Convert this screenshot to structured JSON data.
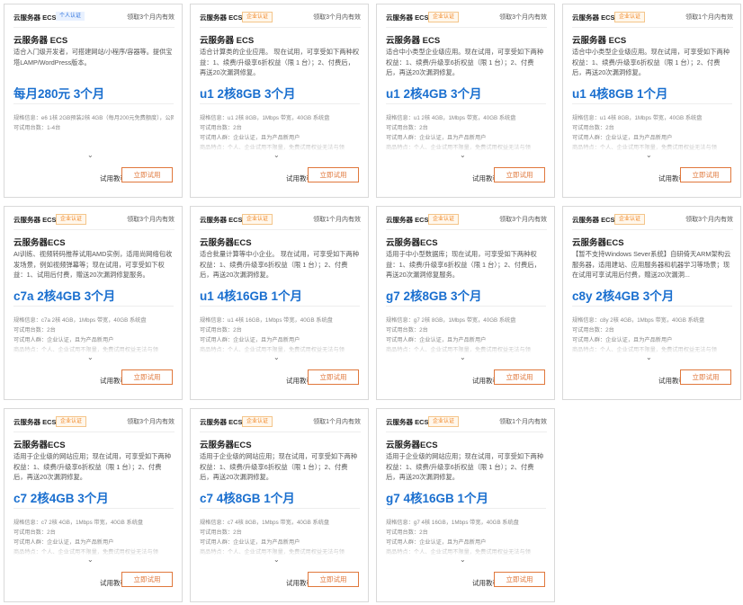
{
  "cards": [
    {
      "brand": "云服务器 ECS",
      "badge": "个人认证",
      "badge_color": "#2a6fdb",
      "validity": "领取3个月内有效",
      "title": "云服务器 ECS",
      "description": "适合入门级开发者，可搭建网站/小程序/容器等。提供宝塔LAMP/WordPress版本。",
      "spec": "每月280元 3个月",
      "details": [
        "规格信息：e6 1核 2GB预装2核 4GB（每月200元免费额度），公网免费额度：超出免费每月80元出免费额度部分需自付",
        "可试用台数：1-4台"
      ],
      "tutorial": "试用教程",
      "button": "立即试用"
    },
    {
      "brand": "云服务器 ECS",
      "badge": "企业认证",
      "badge_color": "#f0821e",
      "validity": "领取3个月内有效",
      "title": "云服务器 ECS",
      "description": "适合计算类的企业应用。 现在试用，可享受如下两种权益：1、续费/升级享6折权益（限 1 台）；2、付费后，再送20次漏洞修复。",
      "spec": "u1 2核8GB 3个月",
      "details": [
        "规格信息：u1 2核 8GB，1Mbps 带宽，40GB 系统盘",
        "可试用台数：2台",
        "可试用人群：企业认证，且为产品新用户",
        "商品特点：个人、企业试用不限量，免费试用权益无法与领"
      ],
      "tutorial": "试用教程",
      "button": "立即试用"
    },
    {
      "brand": "云服务器 ECS",
      "badge": "企业认证",
      "badge_color": "#f0821e",
      "validity": "领取3个月内有效",
      "title": "云服务器 ECS",
      "description": "适合中小类型企业级应用。现在试用，可享受如下两种权益：1、续费/升级享6折权益（限 1 台）；2、付费后，再送20次漏洞修复。",
      "spec": "u1 2核4GB 3个月",
      "details": [
        "规格信息：u1 2核 4GB，1Mbps 带宽，40GB 系统盘",
        "可试用台数：2台",
        "可试用人群：企业认证，且为产品新用户",
        "商品特点：个人、企业试用不限量，免费试用权益无法与领"
      ],
      "tutorial": "试用教程",
      "button": "立即试用"
    },
    {
      "brand": "云服务器 ECS",
      "badge": "企业认证",
      "badge_color": "#f0821e",
      "validity": "领取1个月内有效",
      "title": "云服务器 ECS",
      "description": "适合中小类型企业级应用。现在试用，可享受如下两种权益：1、续费/升级享6折权益（限 1 台）；2、付费后，再送20次漏洞修复。",
      "spec": "u1 4核8GB 1个月",
      "details": [
        "规格信息：u1 4核 8GB，1Mbps 带宽，40GB 系统盘",
        "可试用台数：2台",
        "可试用人群：企业认证，且为产品新用户",
        "商品特点：个人、企业试用不限量，免费试用权益无法与领"
      ],
      "tutorial": "试用教程",
      "button": "立即试用"
    },
    {
      "brand": "云服务器 ECS",
      "badge": "企业认证",
      "badge_color": "#f0821e",
      "validity": "领取3个月内有效",
      "title": "云服务器ECS",
      "description": "AI训练、视频转码推荐试用AMD实例，适用尚网络包收发场景，例如视频弹幕等；现在试用，可享受如下权益：1、试用后付费，赠送20次漏洞修复服务。",
      "spec": "c7a 2核4GB 3个月",
      "details": [
        "规格信息：c7a 2核 4GB，1Mbps 带宽，40GB 系统盘",
        "可试用台数：2台",
        "可试用人群：企业认证，且为产品新用户",
        "商品特点：个人、企业试用不限量，免费试用权益无法与领"
      ],
      "tutorial": "试用教程",
      "button": "立即试用"
    },
    {
      "brand": "云服务器 ECS",
      "badge": "企业认证",
      "badge_color": "#f0821e",
      "validity": "领取1个月内有效",
      "title": "云服务器ECS",
      "description": "适合批量计算等中小企业。 现在试用，可享受如下两种权益：1、续费/升级享6折权益（限 1 台）；2、付费后，再送20次漏洞修复。",
      "spec": "u1 4核16GB 1个月",
      "details": [
        "规格信息：u1 4核 16GB，1Mbps 带宽，40GB 系统盘",
        "可试用台数：2台",
        "可试用人群：企业认证，且为产品新用户",
        "商品特点：个人、企业试用不限量，免费试用权益无法与领"
      ],
      "tutorial": "试用教程",
      "button": "立即试用"
    },
    {
      "brand": "云服务器 ECS",
      "badge": "企业认证",
      "badge_color": "#f0821e",
      "validity": "领取3个月内有效",
      "title": "云服务器ECS",
      "description": "适用于中小型数据库；现在试用，可享受如下两种权益：1、续费/升级享6折权益（限 1 台）；2、付费后，再送20次漏洞修复服务。",
      "spec": "g7 2核8GB 3个月",
      "details": [
        "规格信息：g7 2核 8GB，1Mbps 带宽，40GB 系统盘",
        "可试用台数：2台",
        "可试用人群：企业认证，且为产品新用户",
        "商品特点：个人、企业试用不限量，免费试用权益无法与领"
      ],
      "tutorial": "试用教程",
      "button": "立即试用"
    },
    {
      "brand": "云服务器 ECS",
      "badge": "企业认证",
      "badge_color": "#f0821e",
      "validity": "领取3个月内有效",
      "title": "云服务器ECS",
      "description": "【暂不支持Windows Sever系统】自研倚天ARM架构云服务器，适用建站、应用服务器和机器学习等场景；现在试用可享试用后付费，赠送20次漏洞...",
      "spec": "c8y 2核4GB 3个月",
      "details": [
        "规格信息：c8y 2核 4GB，1Mbps 带宽，40GB 系统盘",
        "可试用台数：2台",
        "可试用人群：企业认证，且为产品新用户",
        "商品特点：个人、企业试用不限量，免费试用权益无法与领"
      ],
      "tutorial": "试用教程",
      "button": "立即试用"
    },
    {
      "brand": "云服务器 ECS",
      "badge": "企业认证",
      "badge_color": "#f0821e",
      "validity": "领取3个月内有效",
      "title": "云服务器ECS",
      "description": "适用于企业级的网站应用；现在试用，可享受如下两种权益：1、续费/升级享6折权益（限 1 台）；2、付费后，再送20次漏洞修复。",
      "spec": "c7 2核4GB 3个月",
      "details": [
        "规格信息：c7 2核 4GB，1Mbps 带宽，40GB 系统盘",
        "可试用台数：2台",
        "可试用人群：企业认证，且为产品新用户",
        "商品特点：个人、企业试用不限量，免费试用权益无法与领"
      ],
      "tutorial": "试用教程",
      "button": "立即试用"
    },
    {
      "brand": "云服务器 ECS",
      "badge": "企业认证",
      "badge_color": "#f0821e",
      "validity": "领取1个月内有效",
      "title": "云服务器ECS",
      "description": "适用于企业级的网站应用；现在试用，可享受如下两种权益：1、续费/升级享6折权益（限 1 台）；2、付费后，再送20次漏洞修复。",
      "spec": "c7 4核8GB 1个月",
      "details": [
        "规格信息：c7 4核 8GB，1Mbps 带宽，40GB 系统盘",
        "可试用台数：2台",
        "可试用人群：企业认证，且为产品新用户",
        "商品特点：个人、企业试用不限量，免费试用权益无法与领"
      ],
      "tutorial": "试用教程",
      "button": "立即试用"
    },
    {
      "brand": "云服务器 ECS",
      "badge": "企业认证",
      "badge_color": "#f0821e",
      "validity": "领取1个月内有效",
      "title": "云服务器ECS",
      "description": "适用于企业级的网站应用；现在试用，可享受如下两种权益：1、续费/升级享6折权益（限 1 台）；2、付费后，再送20次漏洞修复。",
      "spec": "g7 4核16GB 1个月",
      "details": [
        "规格信息：g7 4核 16GB，1Mbps 带宽，40GB 系统盘",
        "可试用台数：2台",
        "可试用人群：企业认证，且为产品新用户",
        "商品特点：个人、企业试用不限量，免费试用权益无法与领"
      ],
      "tutorial": "试用教程",
      "button": "立即试用"
    }
  ]
}
